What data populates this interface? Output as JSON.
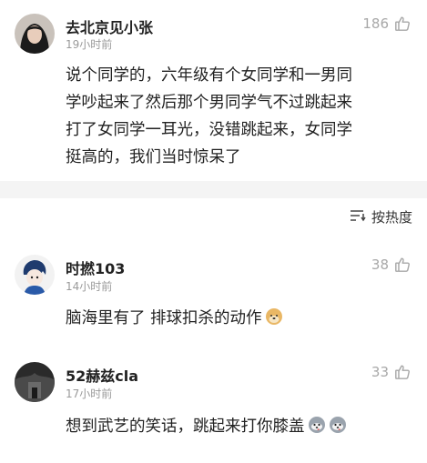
{
  "comments": [
    {
      "name": "去北京见小张",
      "time": "19小时前",
      "likes": "186",
      "lines": [
        "说个同学的，六年级有个女同学和一男同",
        "学吵起来了然后那个男同学气不过跳起来",
        "打了女同学一耳光，没错跳起来，女同学",
        "挺高的，我们当时惊呆了"
      ]
    },
    {
      "name": "时撚103",
      "time": "14小时前",
      "likes": "38",
      "text": "脑海里有了 排球扣杀的动作"
    },
    {
      "name": "52赫兹cla",
      "time": "17小时前",
      "likes": "33",
      "text": "想到武艺的笑话，跳起来打你膝盖"
    }
  ],
  "sort": {
    "label": "按热度"
  },
  "icons": {
    "like": "thumbs-up-icon",
    "sort": "sort-lines-icon",
    "emoji_doge": "doge-emoji",
    "emoji_husky": "husky-emoji"
  }
}
